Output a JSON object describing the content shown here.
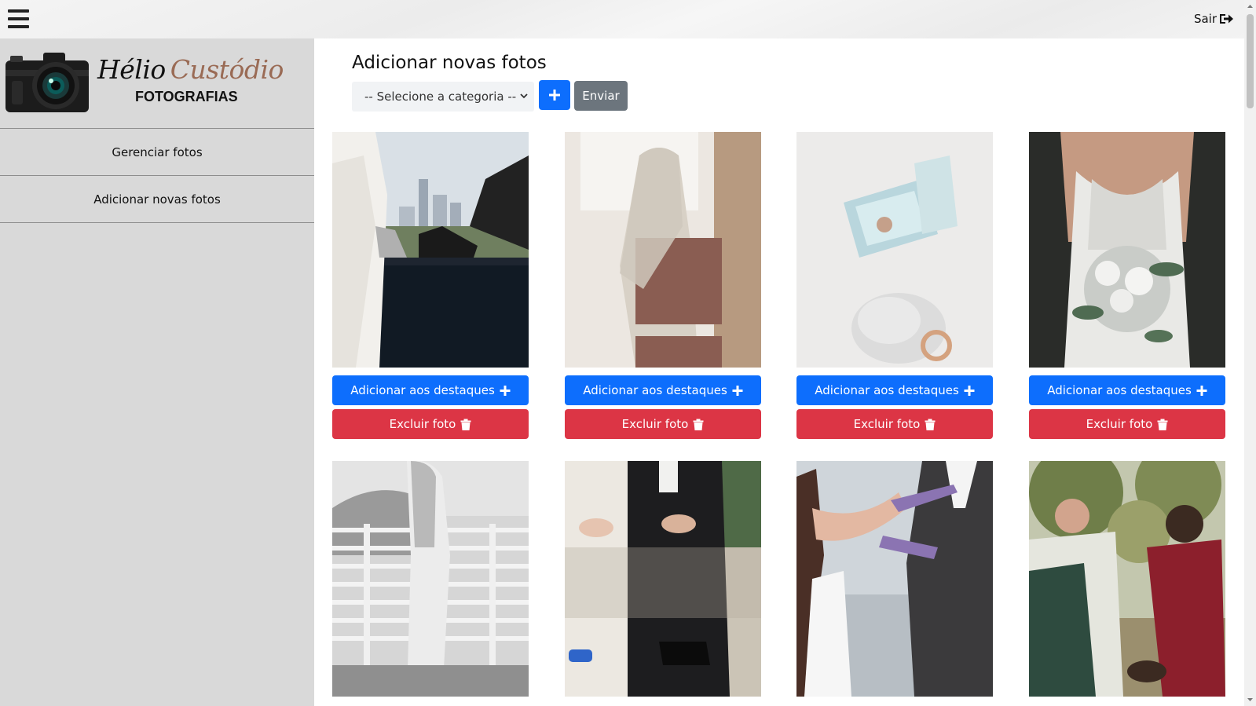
{
  "topbar": {
    "logout_label": "Sair"
  },
  "brand": {
    "first_name": "Hélio",
    "last_name": "Custódio",
    "subtitle": "FOTOGRAFIAS"
  },
  "sidebar": {
    "items": [
      {
        "label": "Gerenciar fotos"
      },
      {
        "label": "Adicionar novas fotos"
      }
    ]
  },
  "main": {
    "title": "Adicionar novas fotos",
    "category_select": {
      "selected": "-- Selecione a categoria --"
    },
    "send_label": "Enviar"
  },
  "photos": {
    "feature_label": "Adicionar aos destaques",
    "delete_label": "Excluir foto",
    "items": [
      {
        "subject": "shoes on rooftop ledge"
      },
      {
        "subject": "bride with veil at window"
      },
      {
        "subject": "ring box and wedding ring"
      },
      {
        "subject": "bride holding white bouquet"
      },
      {
        "subject": "bride in black and white on balcony"
      },
      {
        "subject": "couple seated holding hands"
      },
      {
        "subject": "bride adjusting groom's tie"
      },
      {
        "subject": "couple holding hands in park"
      }
    ]
  },
  "colors": {
    "primary": "#0d6efd",
    "danger": "#dc3545",
    "secondary": "#6c757d",
    "sidebar_bg": "#d9d9d9",
    "brand_accent": "#9a6b55"
  }
}
